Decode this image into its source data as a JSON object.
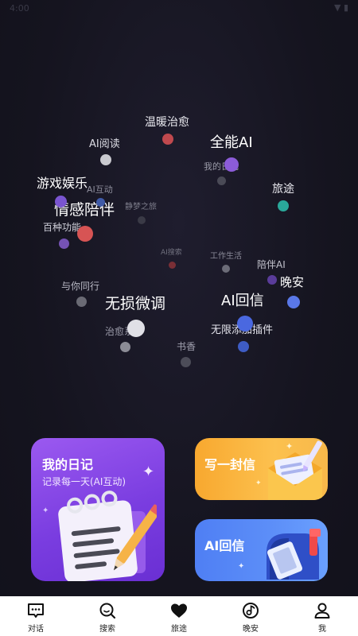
{
  "status_bar": {
    "time": "4:00",
    "icons": "▼ ▮"
  },
  "word_cloud": {
    "words": [
      {
        "text": "温暖治愈"
      },
      {
        "text": "AI阅读"
      },
      {
        "text": "全能AI"
      },
      {
        "text": "我的日记"
      },
      {
        "text": "游戏娱乐"
      },
      {
        "text": "AI互动"
      },
      {
        "text": "旅途"
      },
      {
        "text": "情感陪伴"
      },
      {
        "text": "静梦之旅"
      },
      {
        "text": "百种功能"
      },
      {
        "text": "AI搜索"
      },
      {
        "text": "工作生活"
      },
      {
        "text": "陪伴AI"
      },
      {
        "text": "晚安"
      },
      {
        "text": "与你同行"
      },
      {
        "text": "无损微调"
      },
      {
        "text": "AI回信"
      },
      {
        "text": "治愈系"
      },
      {
        "text": "无限添加插件"
      },
      {
        "text": "书香"
      }
    ]
  },
  "cards": {
    "diary": {
      "title": "我的日记",
      "subtitle": "记录每一天(AI互动)"
    },
    "letter": {
      "title": "写一封信"
    },
    "reply": {
      "title": "AI回信"
    }
  },
  "tabbar": {
    "tabs": [
      {
        "label": "对话",
        "icon": "chat-icon"
      },
      {
        "label": "搜索",
        "icon": "search-icon"
      },
      {
        "label": "旅途",
        "icon": "heart-icon"
      },
      {
        "label": "晚安",
        "icon": "music-icon"
      },
      {
        "label": "我",
        "icon": "person-icon"
      }
    ]
  }
}
